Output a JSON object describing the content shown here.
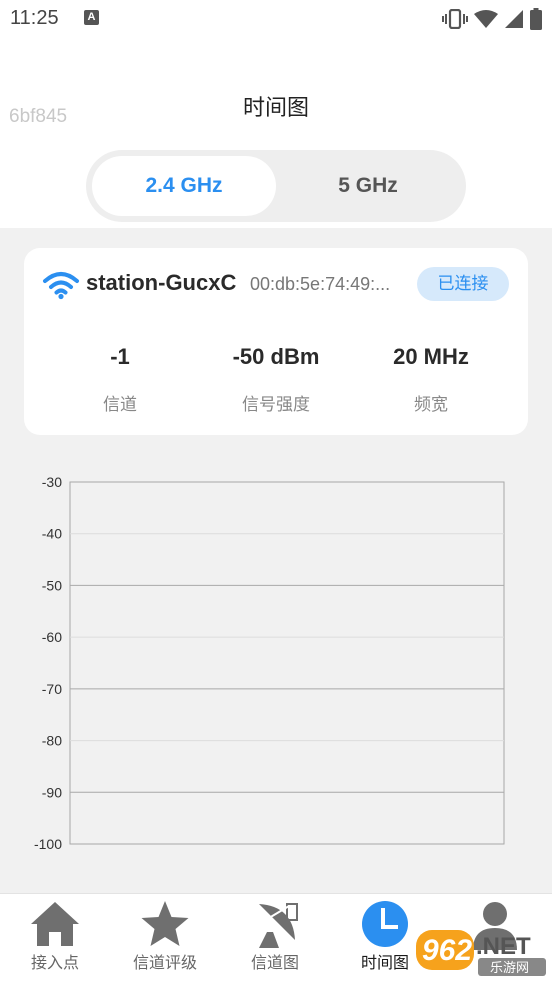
{
  "status_bar": {
    "time": "11:25",
    "notification_glyph": "A",
    "icons": [
      "vibrate-icon",
      "wifi-signal-icon",
      "cell-signal-icon",
      "battery-icon"
    ]
  },
  "header": {
    "build_id": "6bf845",
    "title": "时间图"
  },
  "band_toggle": {
    "options": [
      {
        "label": "2.4 GHz",
        "selected": true
      },
      {
        "label": "5 GHz",
        "selected": false
      }
    ]
  },
  "network_card": {
    "ssid": "station-GucxC",
    "bssid": "00:db:5e:74:49:...",
    "status_badge": "已连接",
    "stats": [
      {
        "value": "-1",
        "label": "信道"
      },
      {
        "value": "-50 dBm",
        "label": "信号强度"
      },
      {
        "value": "20 MHz",
        "label": "频宽"
      }
    ]
  },
  "chart_data": {
    "type": "line",
    "title": "",
    "xlabel": "",
    "ylabel": "",
    "y_ticks": [
      "-30",
      "-40",
      "-50",
      "-60",
      "-70",
      "-80",
      "-90",
      "-100"
    ],
    "ylim": [
      -100,
      -30
    ],
    "series": []
  },
  "bottom_nav": {
    "items": [
      {
        "label": "接入点",
        "icon": "house-icon",
        "active": false
      },
      {
        "label": "信道评级",
        "icon": "star-icon",
        "active": false
      },
      {
        "label": "信道图",
        "icon": "satellite-dish-icon",
        "active": false
      },
      {
        "label": "时间图",
        "icon": "clock-icon",
        "active": true
      },
      {
        "label": "",
        "icon": "person-icon",
        "active": false
      }
    ]
  },
  "watermark": {
    "brand": "962.NET",
    "caption": "乐游网"
  },
  "colors": {
    "accent": "#2b8ff0",
    "badge_bg": "#d6e9fb",
    "page_bg": "#f1f1f1",
    "nav_icon_grey": "#6f6f6f"
  }
}
